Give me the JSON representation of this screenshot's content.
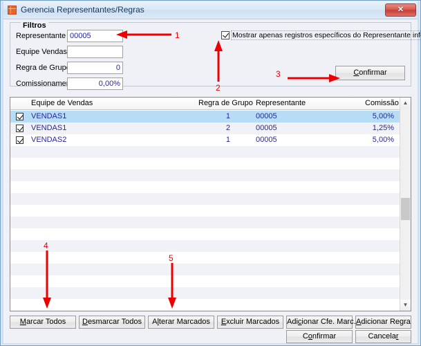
{
  "window": {
    "title": "Gerencia Representantes/Regras",
    "icon": "grid-app-icon",
    "close_label": "✕",
    "accent_title_color": "#12365e",
    "frame_color": "#6f9ac4"
  },
  "filters": {
    "legend": "Filtros",
    "fields": [
      {
        "label": "Representante",
        "value": "00005",
        "align": "left",
        "placeholder": ""
      },
      {
        "label": "Equipe Vendas",
        "value": "",
        "align": "left",
        "placeholder": ""
      },
      {
        "label": "Regra de Grupo",
        "value": "0",
        "align": "right",
        "placeholder": ""
      },
      {
        "label": "Comissionamento",
        "value": "0,00%",
        "align": "right",
        "placeholder": ""
      }
    ],
    "checkbox": {
      "label": "Mostrar apenas registros específicos do Representante informado",
      "checked": true
    },
    "confirm_button": "Confirmar"
  },
  "grid": {
    "columns": [
      {
        "key": "equipe",
        "label": "Equipe de Vendas"
      },
      {
        "key": "regra",
        "label": "Regra de Grupo"
      },
      {
        "key": "representante",
        "label": "Representante"
      },
      {
        "key": "comissao",
        "label": "Comissão"
      }
    ],
    "rows": [
      {
        "checked": true,
        "equipe": "VENDAS1",
        "regra": "1",
        "representante": "00005",
        "comissao": "5,00%",
        "selected": true
      },
      {
        "checked": true,
        "equipe": "VENDAS1",
        "regra": "2",
        "representante": "00005",
        "comissao": "1,25%",
        "selected": false
      },
      {
        "checked": true,
        "equipe": "VENDAS2",
        "regra": "1",
        "representante": "00005",
        "comissao": "5,00%",
        "selected": false
      }
    ],
    "empty_row_count": 14,
    "scrollbar": {
      "up_glyph": "▲",
      "down_glyph": "▼"
    }
  },
  "actions": {
    "row1": [
      {
        "label": "Marcar Todos",
        "accel_index": 0
      },
      {
        "label": "Desmarcar Todos",
        "accel_index": 0
      },
      {
        "label": "Alterar Marcados",
        "accel_index": 1
      },
      {
        "label": "Excluir Marcados",
        "accel_index": 0
      },
      {
        "label": "Adicionar Cfe. Marc.",
        "accel_index": 3
      },
      {
        "label": "Adicionar Regra",
        "accel_index": 0
      }
    ],
    "row2": [
      {
        "label": "Confirmar",
        "accel_index": 1
      },
      {
        "label": "Cancelar",
        "accel_index": 7
      }
    ]
  },
  "annotations": {
    "color": "#ee0000",
    "markers": [
      {
        "id": "1",
        "direction": "left"
      },
      {
        "id": "2",
        "direction": "up"
      },
      {
        "id": "3",
        "direction": "right"
      },
      {
        "id": "4",
        "direction": "down"
      },
      {
        "id": "5",
        "direction": "down"
      }
    ]
  }
}
